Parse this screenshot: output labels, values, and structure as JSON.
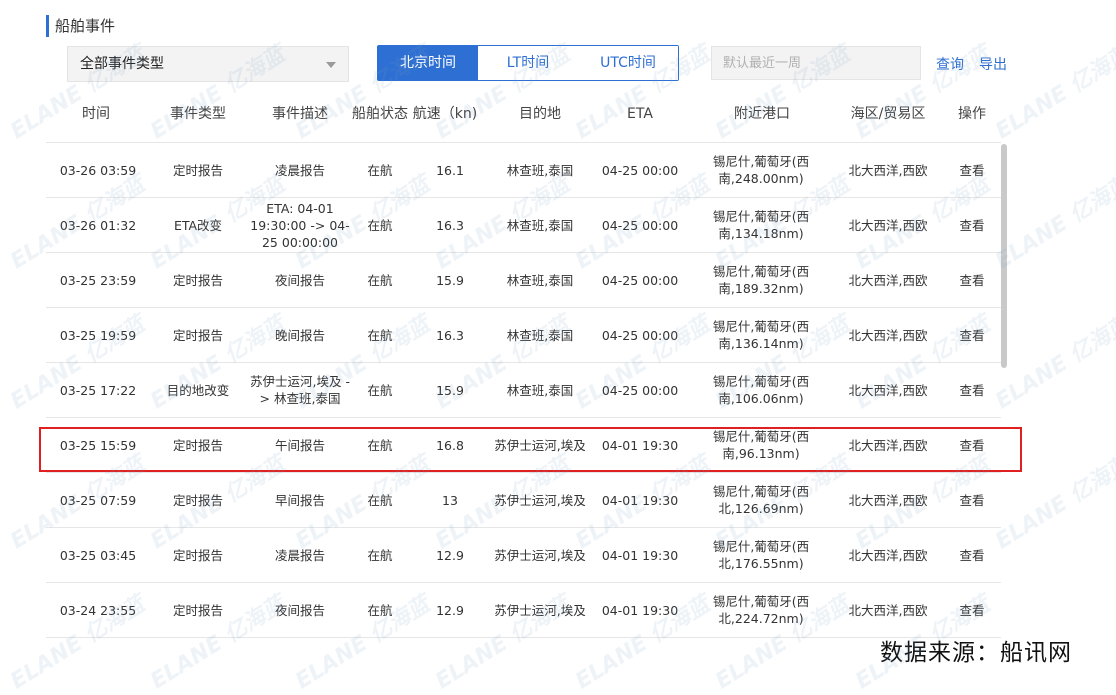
{
  "section": {
    "title": "船舶事件"
  },
  "filters": {
    "event_type": "全部事件类型",
    "time_buttons": [
      {
        "label": "北京时间",
        "active": true
      },
      {
        "label": "LT时间",
        "active": false
      },
      {
        "label": "UTC时间",
        "active": false
      }
    ],
    "date_placeholder": "默认最近一周",
    "query_label": "查询",
    "export_label": "导出"
  },
  "table": {
    "columns": [
      "时间",
      "事件类型",
      "事件描述",
      "船舶状态",
      "航速（kn)",
      "目的地",
      "ETA",
      "附近港口",
      "海区/贸易区",
      "操作"
    ],
    "rows": [
      {
        "time": "03-26 03:59",
        "type": "定时报告",
        "desc": "凌晨报告",
        "status": "在航",
        "speed": "16.1",
        "dest": "林查班,泰国",
        "eta": "04-25 00:00",
        "port": "锡尼什,葡萄牙(西南,248.00nm)",
        "area": "北大西洋,西欧",
        "action": "查看"
      },
      {
        "time": "03-26 01:32",
        "type": "ETA改变",
        "desc": "ETA: 04-01 19:30:00 -> 04-25 00:00:00",
        "status": "在航",
        "speed": "16.3",
        "dest": "林查班,泰国",
        "eta": "04-25 00:00",
        "port": "锡尼什,葡萄牙(西南,134.18nm)",
        "area": "北大西洋,西欧",
        "action": "查看"
      },
      {
        "time": "03-25 23:59",
        "type": "定时报告",
        "desc": "夜间报告",
        "status": "在航",
        "speed": "15.9",
        "dest": "林查班,泰国",
        "eta": "04-25 00:00",
        "port": "锡尼什,葡萄牙(西南,189.32nm)",
        "area": "北大西洋,西欧",
        "action": "查看"
      },
      {
        "time": "03-25 19:59",
        "type": "定时报告",
        "desc": "晚间报告",
        "status": "在航",
        "speed": "16.3",
        "dest": "林查班,泰国",
        "eta": "04-25 00:00",
        "port": "锡尼什,葡萄牙(西南,136.14nm)",
        "area": "北大西洋,西欧",
        "action": "查看"
      },
      {
        "time": "03-25 17:22",
        "type": "目的地改变",
        "desc": "苏伊士运河,埃及 -> 林查班,泰国",
        "status": "在航",
        "speed": "15.9",
        "dest": "林查班,泰国",
        "eta": "04-25 00:00",
        "port": "锡尼什,葡萄牙(西南,106.06nm)",
        "area": "北大西洋,西欧",
        "action": "查看"
      },
      {
        "time": "03-25 15:59",
        "type": "定时报告",
        "desc": "午间报告",
        "status": "在航",
        "speed": "16.8",
        "dest": "苏伊士运河,埃及",
        "eta": "04-01 19:30",
        "port": "锡尼什,葡萄牙(西南,96.13nm)",
        "area": "北大西洋,西欧",
        "action": "查看"
      },
      {
        "time": "03-25 07:59",
        "type": "定时报告",
        "desc": "早间报告",
        "status": "在航",
        "speed": "13",
        "dest": "苏伊士运河,埃及",
        "eta": "04-01 19:30",
        "port": "锡尼什,葡萄牙(西北,126.69nm)",
        "area": "北大西洋,西欧",
        "action": "查看"
      },
      {
        "time": "03-25 03:45",
        "type": "定时报告",
        "desc": "凌晨报告",
        "status": "在航",
        "speed": "12.9",
        "dest": "苏伊士运河,埃及",
        "eta": "04-01 19:30",
        "port": "锡尼什,葡萄牙(西北,176.55nm)",
        "area": "北大西洋,西欧",
        "action": "查看"
      },
      {
        "time": "03-24 23:55",
        "type": "定时报告",
        "desc": "夜间报告",
        "status": "在航",
        "speed": "12.9",
        "dest": "苏伊士运河,埃及",
        "eta": "04-01 19:30",
        "port": "锡尼什,葡萄牙(西北,224.72nm)",
        "area": "北大西洋,西欧",
        "action": "查看"
      }
    ]
  },
  "watermark_text": "ELANE 亿海蓝",
  "source_note": "数据来源：船讯网",
  "colors": {
    "accent": "#2d6fd2",
    "highlight": "#e02020"
  }
}
